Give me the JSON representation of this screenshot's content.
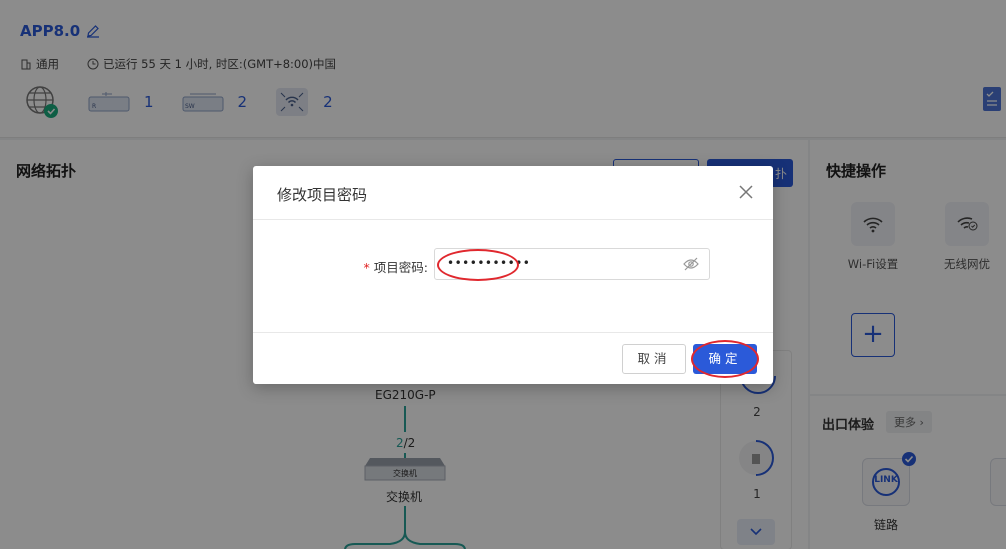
{
  "project": {
    "title": "APP8.0"
  },
  "info": {
    "mode": "通用",
    "uptime": "已运行 55 天 1 小时, 时区:(GMT+8:00)中国"
  },
  "devices": [
    {
      "type": "router",
      "label": "R",
      "count": "1"
    },
    {
      "type": "switch",
      "label": "SW",
      "count": "2"
    },
    {
      "type": "ap",
      "count": "2"
    }
  ],
  "topology": {
    "title": "网络拓扑",
    "primary_btn_suffix": "扑",
    "gateway": "EG210G-P",
    "link_up": "2",
    "link_sep": "/2",
    "switch_label": "交换机",
    "switch_tag": "交换机",
    "zoom_counts": [
      "2",
      "1"
    ]
  },
  "quick_ops": {
    "title": "快捷操作",
    "items": [
      "Wi-Fi设置",
      "无线网优"
    ]
  },
  "exit_exp": {
    "title": "出口体验",
    "more": "更多 ›",
    "link_label": "链路",
    "link_icon": "LINK"
  },
  "dialog": {
    "title": "修改项目密码",
    "field_label": "项目密码:",
    "password_mask": "•••••••••••",
    "cancel": "取消",
    "ok": "确定"
  },
  "colors": {
    "accent": "#2b5ad9",
    "link": "#2aa39a",
    "annotation": "#e0282e"
  }
}
